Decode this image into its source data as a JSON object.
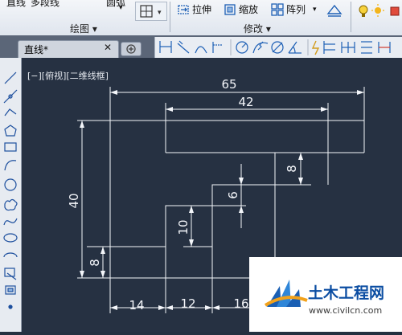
{
  "ribbon": {
    "top_left_text_1": "直线",
    "top_left_text_2": "多段线",
    "top_left_text_3": "圆弧",
    "panel_draw_label": "绘图 ▾",
    "panel_modify_label": "修改 ▾",
    "stretch_label": "拉伸",
    "scale_label": "缩放",
    "array_label": "阵列",
    "array_arrow": "▾"
  },
  "tabs": {
    "active_label": "直线*",
    "close_glyph": "✕"
  },
  "viewport": {
    "view_label": "[−][俯视][二维线框]"
  },
  "dimensions": {
    "d65": "65",
    "d42": "42",
    "d40": "40",
    "d8a": "8",
    "d6": "6",
    "d10": "10",
    "d8b": "8",
    "d14": "14",
    "d12": "12",
    "d16": "16"
  },
  "watermark": {
    "brand": "土木工程网",
    "url": "www.civilcn.com"
  },
  "colors": {
    "canvas_bg": "#263142",
    "geometry": "#ffffff",
    "ribbon_bg": "#e6ebf2"
  }
}
